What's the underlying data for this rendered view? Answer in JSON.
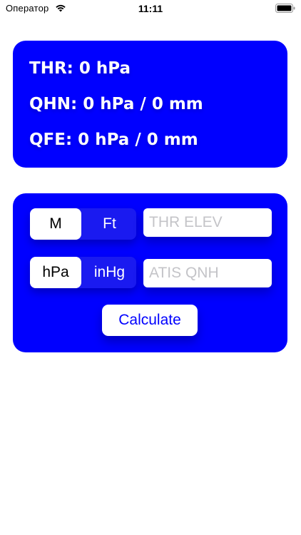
{
  "status_bar": {
    "carrier": "Оператор",
    "time": "11:11",
    "icons": [
      "wifi-icon",
      "battery-icon"
    ]
  },
  "results": {
    "thr": "THR: 0 hPa",
    "qhn": "QHN: 0 hPa / 0 mm",
    "qfe": "QFE: 0 hPa / 0 mm"
  },
  "inputs": {
    "units_segment": {
      "options": [
        "M",
        "Ft"
      ],
      "selected": "M"
    },
    "pressure_segment": {
      "options": [
        "hPa",
        "inHg"
      ],
      "selected": "hPa"
    },
    "thr_elev": {
      "placeholder": "THR ELEV",
      "value": ""
    },
    "atis_qnh": {
      "placeholder": "ATIS QNH",
      "value": ""
    },
    "calculate_label": "Calculate"
  },
  "colors": {
    "accent": "#0000FF",
    "card_text": "#FFFFFF",
    "placeholder": "#C4C4C8"
  }
}
